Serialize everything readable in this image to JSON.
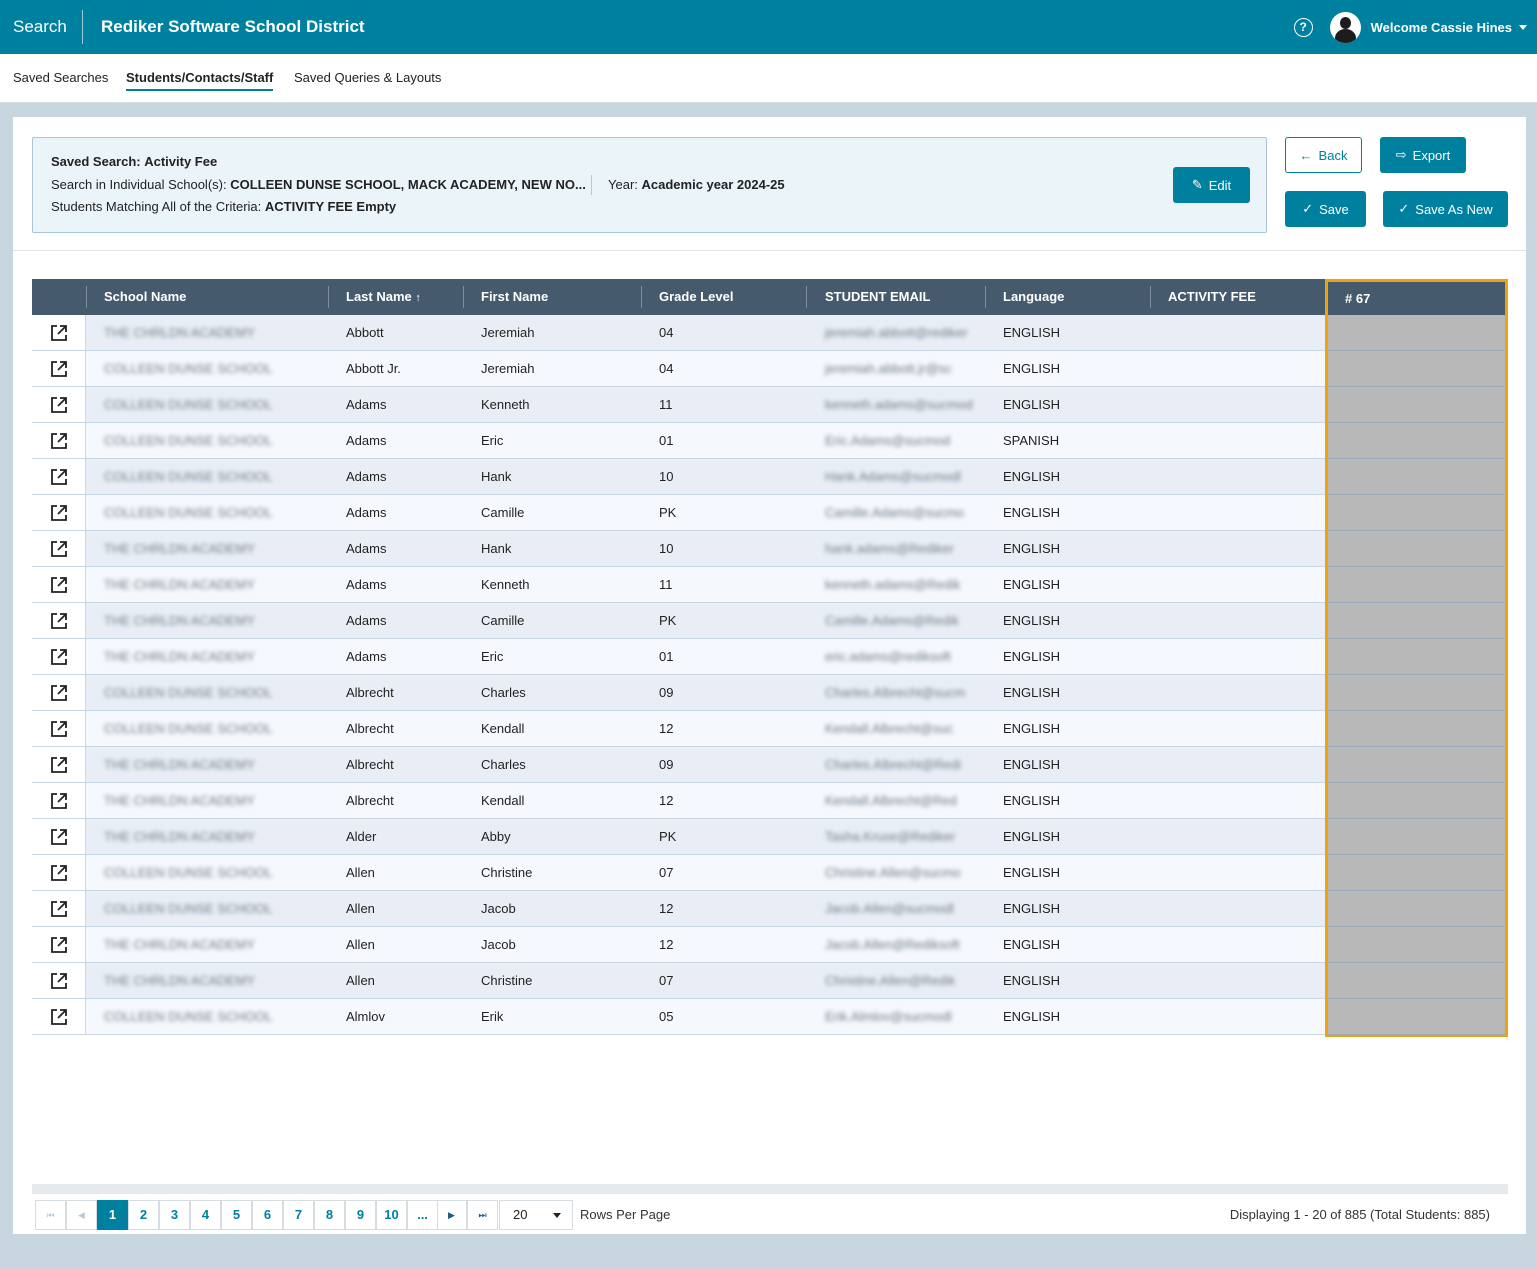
{
  "header": {
    "app_title": "Search",
    "district": "Rediker Software School District",
    "welcome": "Welcome Cassie Hines",
    "help_icon": "?"
  },
  "tabs": [
    "Saved Searches",
    "Students/Contacts/Staff",
    "Saved Queries & Layouts"
  ],
  "summary": {
    "saved_search_label": "Saved Search:",
    "saved_search_value": "Activity Fee",
    "schools_label": "Search in Individual School(s):",
    "schools_value": "COLLEEN DUNSE SCHOOL, MACK ACADEMY, NEW NO...",
    "year_label": "Year:",
    "year_value": "Academic year 2024-25",
    "criteria_label": "Students Matching All of the Criteria:",
    "criteria_value": "ACTIVITY FEE Empty"
  },
  "buttons": {
    "edit": "Edit",
    "back": "Back",
    "export": "Export",
    "save": "Save",
    "save_as_new": "Save As New"
  },
  "columns": {
    "school": "School Name",
    "last": "Last Name",
    "first": "First Name",
    "grade": "Grade Level",
    "email": "STUDENT EMAIL",
    "language": "Language",
    "fee": "ACTIVITY FEE",
    "count": "# 67"
  },
  "rows": [
    {
      "school": "THE CHRLDN ACADEMY",
      "last": "Abbott",
      "first": "Jeremiah",
      "grade": "04",
      "email": "jeremiah.abbott@rediker",
      "language": "ENGLISH"
    },
    {
      "school": "COLLEEN DUNSE SCHOOL",
      "last": "Abbott Jr.",
      "first": "Jeremiah",
      "grade": "04",
      "email": "jeremiah.abbott.jr@sc",
      "language": "ENGLISH"
    },
    {
      "school": "COLLEEN DUNSE SCHOOL",
      "last": "Adams",
      "first": "Kenneth",
      "grade": "11",
      "email": "kenneth.adams@sucmod",
      "language": "ENGLISH"
    },
    {
      "school": "COLLEEN DUNSE SCHOOL",
      "last": "Adams",
      "first": "Eric",
      "grade": "01",
      "email": "Eric.Adams@sucmod",
      "language": "SPANISH"
    },
    {
      "school": "COLLEEN DUNSE SCHOOL",
      "last": "Adams",
      "first": "Hank",
      "grade": "10",
      "email": "Hank.Adams@sucmodl",
      "language": "ENGLISH"
    },
    {
      "school": "COLLEEN DUNSE SCHOOL",
      "last": "Adams",
      "first": "Camille",
      "grade": "PK",
      "email": "Camille.Adams@sucmo",
      "language": "ENGLISH"
    },
    {
      "school": "THE CHRLDN ACADEMY",
      "last": "Adams",
      "first": "Hank",
      "grade": "10",
      "email": "hank.adams@Rediker",
      "language": "ENGLISH"
    },
    {
      "school": "THE CHRLDN ACADEMY",
      "last": "Adams",
      "first": "Kenneth",
      "grade": "11",
      "email": "kenneth.adams@Redik",
      "language": "ENGLISH"
    },
    {
      "school": "THE CHRLDN ACADEMY",
      "last": "Adams",
      "first": "Camille",
      "grade": "PK",
      "email": "Camille.Adams@Redik",
      "language": "ENGLISH"
    },
    {
      "school": "THE CHRLDN ACADEMY",
      "last": "Adams",
      "first": "Eric",
      "grade": "01",
      "email": "eric.adams@rediksoft",
      "language": "ENGLISH"
    },
    {
      "school": "COLLEEN DUNSE SCHOOL",
      "last": "Albrecht",
      "first": "Charles",
      "grade": "09",
      "email": "Charles.Albrecht@sucm",
      "language": "ENGLISH"
    },
    {
      "school": "COLLEEN DUNSE SCHOOL",
      "last": "Albrecht",
      "first": "Kendall",
      "grade": "12",
      "email": "Kendall.Albrecht@suc",
      "language": "ENGLISH"
    },
    {
      "school": "THE CHRLDN ACADEMY",
      "last": "Albrecht",
      "first": "Charles",
      "grade": "09",
      "email": "Charles.Albrecht@Redi",
      "language": "ENGLISH"
    },
    {
      "school": "THE CHRLDN ACADEMY",
      "last": "Albrecht",
      "first": "Kendall",
      "grade": "12",
      "email": "Kendall.Albrecht@Red",
      "language": "ENGLISH"
    },
    {
      "school": "THE CHRLDN ACADEMY",
      "last": "Alder",
      "first": "Abby",
      "grade": "PK",
      "email": "Tasha.Kruse@Rediker",
      "language": "ENGLISH"
    },
    {
      "school": "COLLEEN DUNSE SCHOOL",
      "last": "Allen",
      "first": "Christine",
      "grade": "07",
      "email": "Christine.Allen@sucmo",
      "language": "ENGLISH"
    },
    {
      "school": "COLLEEN DUNSE SCHOOL",
      "last": "Allen",
      "first": "Jacob",
      "grade": "12",
      "email": "Jacob.Allen@sucmodl",
      "language": "ENGLISH"
    },
    {
      "school": "THE CHRLDN ACADEMY",
      "last": "Allen",
      "first": "Jacob",
      "grade": "12",
      "email": "Jacob.Allen@Rediksoft",
      "language": "ENGLISH"
    },
    {
      "school": "THE CHRLDN ACADEMY",
      "last": "Allen",
      "first": "Christine",
      "grade": "07",
      "email": "Christine.Allen@Redik",
      "language": "ENGLISH"
    },
    {
      "school": "COLLEEN DUNSE SCHOOL",
      "last": "Almlov",
      "first": "Erik",
      "grade": "05",
      "email": "Erik.Almlov@sucmodl",
      "language": "ENGLISH"
    }
  ],
  "pager": {
    "pages": [
      "1",
      "2",
      "3",
      "4",
      "5",
      "6",
      "7",
      "8",
      "9",
      "10",
      "..."
    ],
    "current_page": "1",
    "rows_per_page": "20",
    "rows_per_page_label": "Rows Per Page",
    "info": "Displaying  1 - 20  of  885 (Total Students: 885)"
  },
  "colors": {
    "brand": "#00809f",
    "header_bg": "#455a6c",
    "highlight": "#f0a30a"
  }
}
